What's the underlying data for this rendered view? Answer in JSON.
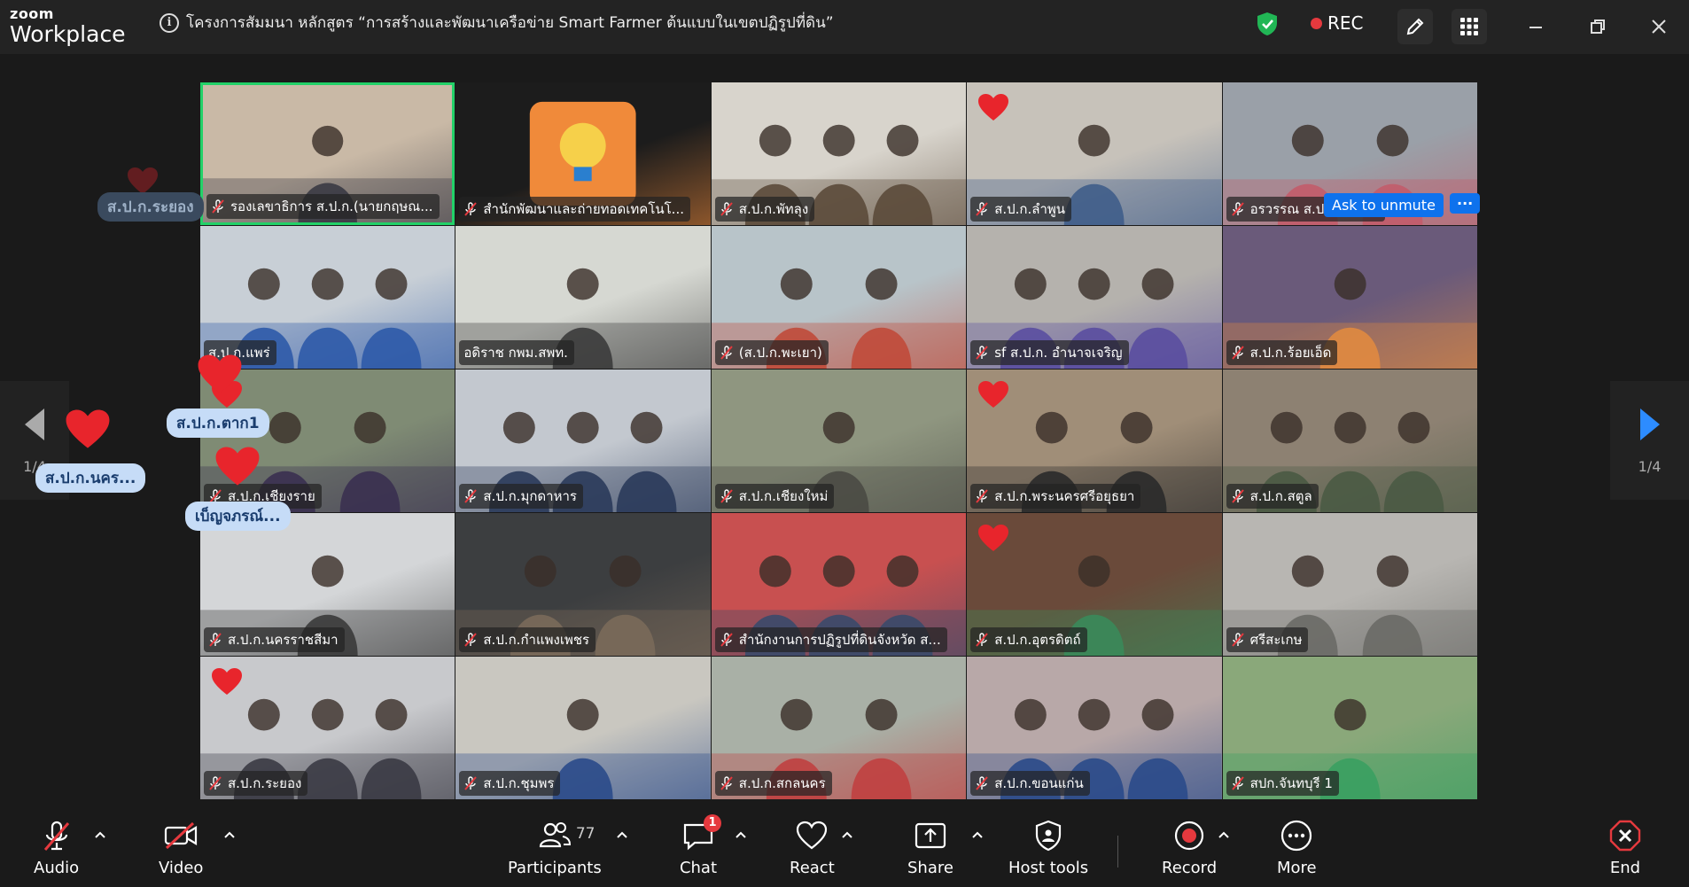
{
  "app": {
    "logo_top": "zoom",
    "logo_bottom": "Workplace"
  },
  "meeting": {
    "title": "โครงการสัมมนา หลักสูตร “การสร้างและพัฒนาเครือข่าย Smart Farmer ต้นแบบในเขตปฏิรูปที่ดิน”"
  },
  "titlebar": {
    "rec_label": "REC"
  },
  "nav": {
    "page_left": "1/4",
    "page_right": "1/4"
  },
  "tiles": [
    {
      "name": "รองเลขาธิการ ส.ป.ก.(นายกฤษณ...",
      "muted": true,
      "bg": "#c9b9a6",
      "accent": "#3a3a44"
    },
    {
      "name": "สำนักพัฒนาและถ่ายทอดเทคโนโ...",
      "muted": true,
      "bg": "#1c1c1c",
      "accent": "#f08a3a"
    },
    {
      "name": "ส.ป.ก.พัทลุง",
      "muted": true,
      "bg": "#d8d4cc",
      "accent": "#5b4a3a"
    },
    {
      "name": "ส.ป.ก.ลำพูน",
      "muted": true,
      "bg": "#c7c2ba",
      "accent": "#3f5d8a"
    },
    {
      "name": "อรวรรณ ส.ป.ก.ยโสธร",
      "muted": true,
      "bg": "#9aa0a8",
      "accent": "#c25c6a"
    },
    {
      "name": "ส.ป.ก.แพร่",
      "muted": false,
      "bg": "#c8cfd6",
      "accent": "#2d5aa8"
    },
    {
      "name": "อดิราช กพม.สพท.",
      "muted": false,
      "bg": "#d6d8d2",
      "accent": "#3b3b3b"
    },
    {
      "name": "(ส.ป.ก.พะเยา)",
      "muted": true,
      "bg": "#b8c4c9",
      "accent": "#c04a3a"
    },
    {
      "name": "sf ส.ป.ก. อำนาจเจริญ",
      "muted": true,
      "bg": "#b5b2ad",
      "accent": "#5a4ea0"
    },
    {
      "name": "ส.ป.ก.ร้อยเอ็ด",
      "muted": true,
      "bg": "#6a5a7a",
      "accent": "#e08a40"
    },
    {
      "name": "ส.ป.ก.เชียงราย",
      "muted": true,
      "bg": "#7f8b74",
      "accent": "#3a3050"
    },
    {
      "name": "ส.ป.ก.มุกดาหาร",
      "muted": true,
      "bg": "#c3c8cf",
      "accent": "#2a3a5a"
    },
    {
      "name": "ส.ป.ก.เชียงใหม่",
      "muted": true,
      "bg": "#8f9680",
      "accent": "#4a4a44"
    },
    {
      "name": "ส.ป.ก.พระนครศรีอยุธยา",
      "muted": true,
      "bg": "#a08e78",
      "accent": "#2a2a2a"
    },
    {
      "name": "ส.ป.ก.สตูล",
      "muted": true,
      "bg": "#8d8172",
      "accent": "#4a5a44"
    },
    {
      "name": "ส.ป.ก.นครราชสีมา",
      "muted": true,
      "bg": "#d4d6d8",
      "accent": "#3a3a3a"
    },
    {
      "name": "ส.ป.ก.กำแพงเพชร",
      "muted": true,
      "bg": "#3c3e40",
      "accent": "#7a6a5a"
    },
    {
      "name": "สำนักงานการปฏิรูปที่ดินจังหวัด ส...",
      "muted": true,
      "bg": "#c85050",
      "accent": "#3a4a6a"
    },
    {
      "name": "ส.ป.ก.อุตรดิตถ์",
      "muted": true,
      "bg": "#6a4a3a",
      "accent": "#3a8a5a"
    },
    {
      "name": "ศรีสะเกษ",
      "muted": true,
      "bg": "#b8b6b2",
      "accent": "#6a6a66"
    },
    {
      "name": "ส.ป.ก.ระยอง",
      "muted": true,
      "bg": "#c8c9cc",
      "accent": "#3a3a44"
    },
    {
      "name": "ส.ป.ก.ชุมพร",
      "muted": true,
      "bg": "#c9c7c0",
      "accent": "#2a4a8a"
    },
    {
      "name": "ส.ป.ก.สกลนคร",
      "muted": true,
      "bg": "#a9b0a6",
      "accent": "#c04040"
    },
    {
      "name": "ส.ป.ก.ขอนแก่น",
      "muted": true,
      "bg": "#b8a8a8",
      "accent": "#2a4a8a"
    },
    {
      "name": "สปก.จันทบุรี 1",
      "muted": true,
      "bg": "#8aa87a",
      "accent": "#3aa060"
    }
  ],
  "ask_unmute": {
    "label": "Ask to unmute",
    "more": "···"
  },
  "floating_names": {
    "rayong": "ส.ป.ก.ระยอง",
    "tak": "ส.ป.ก.ตาก1",
    "nakhon": "ส.ป.ก.นคร...",
    "benjaporn": "เบ็ญจภรณ์..."
  },
  "toolbar": {
    "audio": "Audio",
    "video": "Video",
    "participants": "Participants",
    "participants_count": "77",
    "chat": "Chat",
    "chat_badge": "1",
    "react": "React",
    "share": "Share",
    "host_tools": "Host tools",
    "record": "Record",
    "more": "More",
    "end": "End"
  },
  "colors": {
    "active_speaker": "#22d168",
    "rec": "#e5393e",
    "accent_blue": "#0e72ed",
    "heart": "#e8252c"
  }
}
